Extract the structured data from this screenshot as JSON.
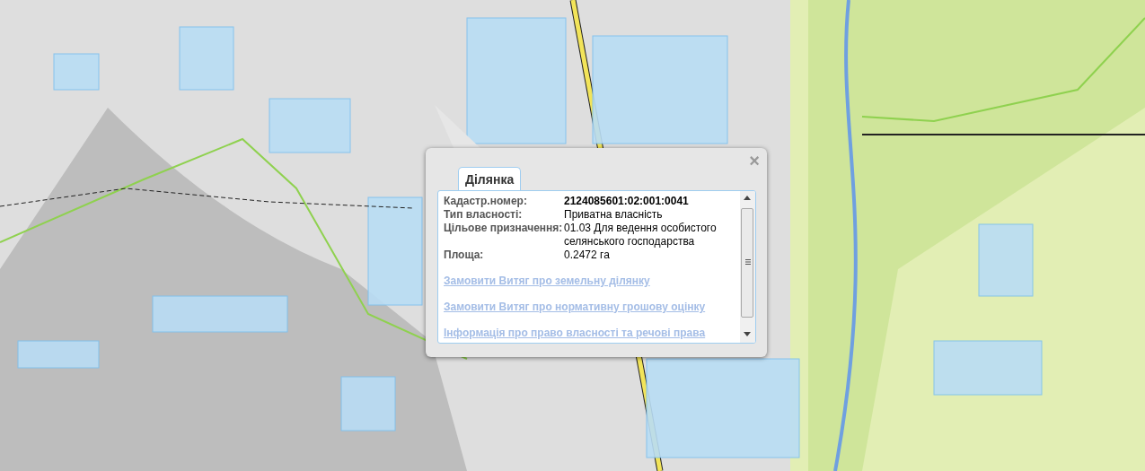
{
  "popup": {
    "close": "×",
    "tab": {
      "label": "Ділянка",
      "selected": true
    },
    "fields": [
      {
        "label": "Кадастр.номер:",
        "value": "2124085601:02:001:0041",
        "bold": true
      },
      {
        "label": "Тип власності:",
        "value": "Приватна власність",
        "bold": false
      },
      {
        "label": "Цільове призначення:",
        "value": "01.03 Для ведення особистого селянського господарства",
        "bold": false
      },
      {
        "label": "Площа:",
        "value": "0.2472 га",
        "bold": false
      }
    ],
    "links": [
      "Замовити Витяг про земельну ділянку",
      "Замовити Витяг про нормативну грошову оцінку",
      "Інформація про право власності та речові права"
    ]
  }
}
